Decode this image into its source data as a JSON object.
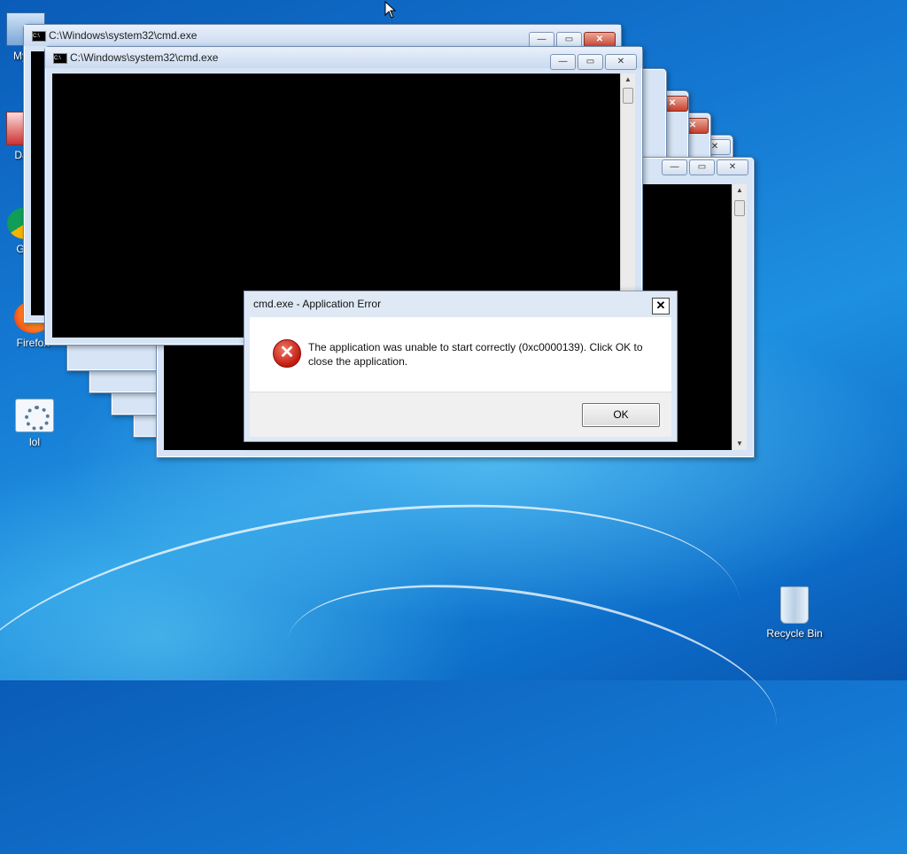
{
  "desktop": {
    "icons": [
      {
        "label": "My C",
        "icon": "computer-icon"
      },
      {
        "label": "Data",
        "icon": "shortcut-icon"
      },
      {
        "label": "G C",
        "icon": "chrome-icon"
      },
      {
        "label": "Firefox",
        "icon": "firefox-icon"
      },
      {
        "label": "lol",
        "icon": "settings-app-icon"
      },
      {
        "label": "Recycle Bin",
        "icon": "recycle-bin-icon"
      }
    ]
  },
  "cmd_windows": [
    {
      "title": "C:\\Windows\\system32\\cmd.exe"
    },
    {
      "title": "C:\\Windows\\system32\\cmd.exe"
    }
  ],
  "window_controls": {
    "minimize": "—",
    "maximize": "▭",
    "close": "✕"
  },
  "dialog": {
    "title": "cmd.exe - Application Error",
    "close": "✕",
    "icon": "error-icon",
    "message": "The application was unable to start correctly (0xc0000139). Click OK to close the application.",
    "ok_label": "OK"
  }
}
